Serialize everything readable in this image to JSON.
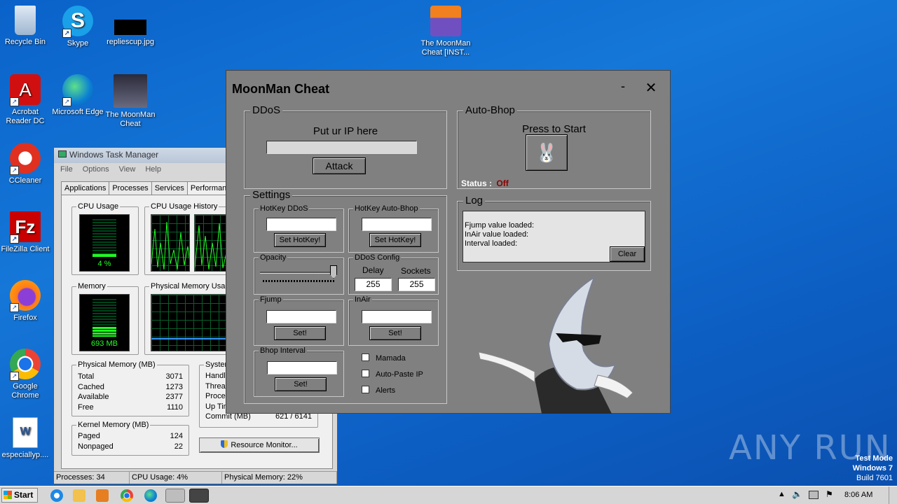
{
  "desktop": {
    "icons": [
      {
        "label": "Recycle Bin",
        "icon": "recycle-bin-icon"
      },
      {
        "label": "Skype",
        "icon": "skype-icon"
      },
      {
        "label": "repliescup.jpg",
        "icon": "image-file-icon"
      },
      {
        "label": "The MoonMan Cheat [INST...",
        "icon": "installer-icon"
      },
      {
        "label": "Acrobat Reader DC",
        "icon": "acrobat-icon"
      },
      {
        "label": "Microsoft Edge",
        "icon": "edge-icon"
      },
      {
        "label": "The MoonMan Cheat",
        "icon": "moonman-app-icon"
      },
      {
        "label": "CCleaner",
        "icon": "ccleaner-icon"
      },
      {
        "label": "FileZilla Client",
        "icon": "filezilla-icon"
      },
      {
        "label": "Firefox",
        "icon": "firefox-icon"
      },
      {
        "label": "Google Chrome",
        "icon": "chrome-icon"
      },
      {
        "label": "especiallyp....",
        "icon": "word-doc-icon"
      }
    ],
    "watermark": "ANY RUN",
    "test_mode": [
      "Test Mode",
      "Windows 7",
      "Build 7601"
    ]
  },
  "taskmgr": {
    "title": "Windows Task Manager",
    "menu": [
      "File",
      "Options",
      "View",
      "Help"
    ],
    "tabs": [
      "Applications",
      "Processes",
      "Services",
      "Performan"
    ],
    "cpu_usage": {
      "label": "CPU Usage",
      "value": "4 %",
      "level": 0.04
    },
    "cpu_history": {
      "label": "CPU Usage History"
    },
    "memory": {
      "label": "Memory",
      "value": "693 MB",
      "level": 0.22
    },
    "phys_history": {
      "label": "Physical Memory Usage"
    },
    "physical_memory": {
      "label": "Physical Memory (MB)",
      "rows": [
        [
          "Total",
          "3071"
        ],
        [
          "Cached",
          "1273"
        ],
        [
          "Available",
          "2377"
        ],
        [
          "Free",
          "1110"
        ]
      ]
    },
    "kernel_memory": {
      "label": "Kernel Memory (MB)",
      "rows": [
        [
          "Paged",
          "124"
        ],
        [
          "Nonpaged",
          "22"
        ]
      ]
    },
    "system": {
      "label": "System",
      "rows": [
        "Handle",
        "Thread",
        "Proces",
        "Up Tim"
      ],
      "commit_label": "Commit (MB)",
      "commit_value": "621 / 6141"
    },
    "resource_monitor": "Resource Monitor...",
    "status": [
      "Processes: 34",
      "CPU Usage: 4%",
      "Physical Memory: 22%"
    ]
  },
  "moonman": {
    "title": "MoonMan Cheat",
    "minimize": "-",
    "close": "✕",
    "ddos": {
      "label": "DDoS",
      "prompt": "Put ur IP here",
      "ip_value": "",
      "attack": "Attack"
    },
    "settings": {
      "label": "Settings",
      "hotkey_ddos": {
        "label": "HotKey DDoS",
        "value": "",
        "button": "Set HotKey!"
      },
      "hotkey_bhop": {
        "label": "HotKey Auto-Bhop",
        "value": "",
        "button": "Set HotKey!"
      },
      "opacity": {
        "label": "Opacity",
        "level": 1.0
      },
      "ddos_config": {
        "label": "DDoS Config",
        "delay_label": "Delay",
        "sockets_label": "Sockets",
        "delay": "255",
        "sockets": "255"
      },
      "fjump": {
        "label": "Fjump",
        "value": "",
        "button": "Set!"
      },
      "inair": {
        "label": "InAir",
        "value": "",
        "button": "Set!"
      },
      "bhop_interval": {
        "label": "Bhop Interval",
        "value": "",
        "button": "Set!"
      },
      "checkboxes": [
        {
          "label": "Mamada",
          "checked": false
        },
        {
          "label": "Auto-Paste IP",
          "checked": false
        },
        {
          "label": "Alerts",
          "checked": false
        }
      ]
    },
    "autobhop": {
      "label": "Auto-Bhop",
      "prompt": "Press to Start",
      "status_label": "Status :",
      "status_value": "Off",
      "status_color": "#8b0000"
    },
    "log": {
      "label": "Log",
      "lines": [
        "Fjump value loaded:",
        "InAir value loaded:",
        "Interval loaded:"
      ],
      "clear": "Clear"
    }
  },
  "taskbar": {
    "start": "Start",
    "clock": "8:06 AM"
  }
}
